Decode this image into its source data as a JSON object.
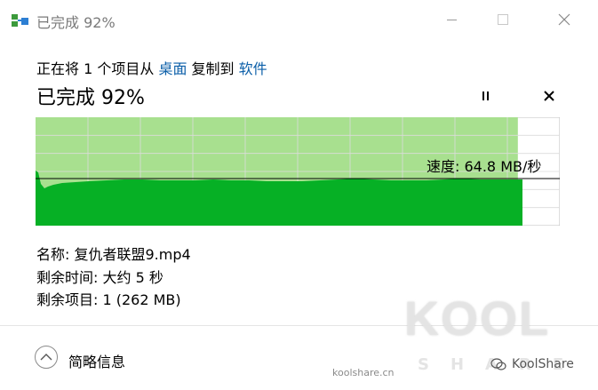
{
  "window": {
    "title": "已完成 92%"
  },
  "copy": {
    "prefix": "正在将 1 个项目从 ",
    "source": "桌面",
    "middle": " 复制到 ",
    "destination": "软件"
  },
  "progress": {
    "heading": "已完成 92%",
    "percent": 92
  },
  "speed": {
    "label": "速度: 64.8 MB/秒"
  },
  "details": {
    "name": "名称:  复仇者联盟9.mp4",
    "time_remaining": "剩余时间:  大约 5 秒",
    "items_remaining": "剩余项目:  1 (262 MB)"
  },
  "footer": {
    "more_info": "简略信息"
  },
  "watermark": {
    "logo": "KOOL",
    "sub": "SHARE",
    "site": "koolshare.cn",
    "brand": "KoolShare"
  },
  "colors": {
    "progress_fill": "#a8e08f",
    "speed_area": "#06b025",
    "link": "#0a5ea8"
  }
}
